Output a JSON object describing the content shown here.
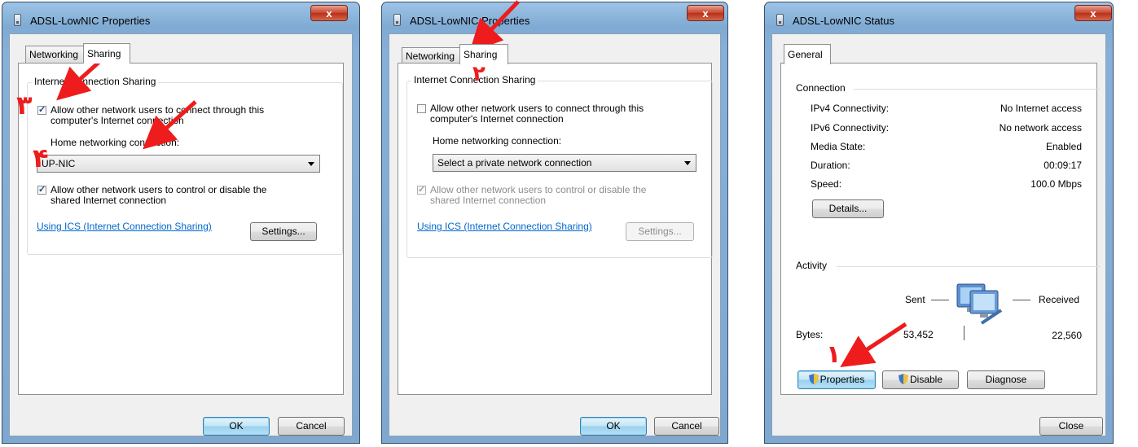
{
  "left": {
    "title": "ADSL-LowNIC Properties",
    "close": "x",
    "tabs": [
      "Networking",
      "Sharing"
    ],
    "group_title": "Internet Connection Sharing",
    "allow_connect": "Allow other network users to connect through this computer's Internet connection",
    "home_label": "Home networking connection:",
    "home_value": "UP-NIC",
    "allow_control": "Allow other network users to control or disable the shared Internet connection",
    "link": "Using ICS (Internet Connection Sharing)",
    "settings": "Settings...",
    "ok": "OK",
    "cancel": "Cancel",
    "marks": [
      "٣",
      "۴"
    ]
  },
  "mid": {
    "title": "ADSL-LowNIC Properties",
    "close": "x",
    "tabs": [
      "Networking",
      "Sharing"
    ],
    "group_title": "Internet Connection Sharing",
    "allow_connect": "Allow other network users to connect through this computer's Internet connection",
    "home_label": "Home networking connection:",
    "home_value": "Select a private network connection",
    "allow_control": "Allow other network users to control or disable the shared Internet connection",
    "link": "Using ICS (Internet Connection Sharing)",
    "settings": "Settings...",
    "ok": "OK",
    "cancel": "Cancel",
    "marks": [
      "۲"
    ]
  },
  "right": {
    "title": "ADSL-LowNIC Status",
    "close": "x",
    "tab": "General",
    "connection_title": "Connection",
    "rows": [
      {
        "label": "IPv4 Connectivity:",
        "value": "No Internet access"
      },
      {
        "label": "IPv6 Connectivity:",
        "value": "No network access"
      },
      {
        "label": "Media State:",
        "value": "Enabled"
      },
      {
        "label": "Duration:",
        "value": "00:09:17"
      },
      {
        "label": "Speed:",
        "value": "100.0 Mbps"
      }
    ],
    "details": "Details...",
    "activity_title": "Activity",
    "sent": "Sent",
    "received": "Received",
    "bytes_label": "Bytes:",
    "bytes_sent": "53,452",
    "bytes_received": "22,560",
    "properties": "Properties",
    "disable": "Disable",
    "diagnose": "Diagnose",
    "close_btn": "Close",
    "marks": [
      "١"
    ]
  },
  "colors": {
    "annotation": "#ee1c1c",
    "link": "#0066cc",
    "close_button": "#c8432d"
  }
}
